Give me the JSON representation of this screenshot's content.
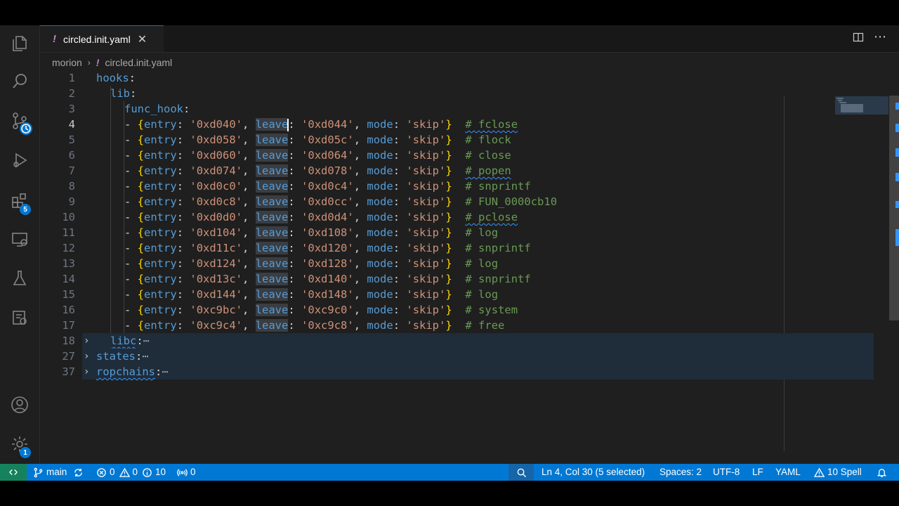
{
  "tab": {
    "icon": "!",
    "filename": "circled.init.yaml",
    "close": "✕"
  },
  "breadcrumb": {
    "folder": "morion",
    "separator": "›",
    "icon": "!",
    "file": "circled.init.yaml"
  },
  "activity": {
    "extensions_badge": "5",
    "settings_badge": "1"
  },
  "editor": {
    "line_numbers": [
      "1",
      "2",
      "3",
      "4",
      "5",
      "6",
      "7",
      "8",
      "9",
      "10",
      "11",
      "12",
      "13",
      "14",
      "15",
      "16",
      "17",
      "18",
      "27",
      "37"
    ],
    "l1_key": "hooks",
    "l2_key": "lib",
    "l3_key": "func_hook",
    "hooks": [
      {
        "entry": "'0xd040'",
        "leave": "'0xd044'",
        "mode": "'skip'",
        "comment": "# fclose"
      },
      {
        "entry": "'0xd058'",
        "leave": "'0xd05c'",
        "mode": "'skip'",
        "comment": "# flock"
      },
      {
        "entry": "'0xd060'",
        "leave": "'0xd064'",
        "mode": "'skip'",
        "comment": "# close"
      },
      {
        "entry": "'0xd074'",
        "leave": "'0xd078'",
        "mode": "'skip'",
        "comment": "# popen"
      },
      {
        "entry": "'0xd0c0'",
        "leave": "'0xd0c4'",
        "mode": "'skip'",
        "comment": "# snprintf"
      },
      {
        "entry": "'0xd0c8'",
        "leave": "'0xd0cc'",
        "mode": "'skip'",
        "comment": "# FUN_0000cb10"
      },
      {
        "entry": "'0xd0d0'",
        "leave": "'0xd0d4'",
        "mode": "'skip'",
        "comment": "# pclose"
      },
      {
        "entry": "'0xd104'",
        "leave": "'0xd108'",
        "mode": "'skip'",
        "comment": "# log"
      },
      {
        "entry": "'0xd11c'",
        "leave": "'0xd120'",
        "mode": "'skip'",
        "comment": "# snprintf"
      },
      {
        "entry": "'0xd124'",
        "leave": "'0xd128'",
        "mode": "'skip'",
        "comment": "# log"
      },
      {
        "entry": "'0xd13c'",
        "leave": "'0xd140'",
        "mode": "'skip'",
        "comment": "# snprintf"
      },
      {
        "entry": "'0xd144'",
        "leave": "'0xd148'",
        "mode": "'skip'",
        "comment": "# log"
      },
      {
        "entry": "'0xc9bc'",
        "leave": "'0xc9c0'",
        "mode": "'skip'",
        "comment": "# system"
      },
      {
        "entry": "'0xc9c4'",
        "leave": "'0xc9c8'",
        "mode": "'skip'",
        "comment": "# free"
      }
    ],
    "folded": [
      {
        "key": "libc",
        "ellipsis": "⋯"
      },
      {
        "key": "states",
        "ellipsis": "⋯"
      },
      {
        "key": "ropchains",
        "ellipsis": "⋯"
      }
    ]
  },
  "statusbar": {
    "branch": "main",
    "errors": "0",
    "warnings": "0",
    "infos": "10",
    "ports": "0",
    "cursor_position": "Ln 4, Col 30 (5 selected)",
    "indent": "Spaces: 2",
    "encoding": "UTF-8",
    "eol": "LF",
    "language": "YAML",
    "spell": "10 Spell"
  },
  "colors": {
    "statusbar": "#0078d4",
    "remote": "#16825d",
    "key": "#569cd6",
    "string": "#ce9178",
    "comment": "#6a9955",
    "bracket": "#ffd700"
  }
}
